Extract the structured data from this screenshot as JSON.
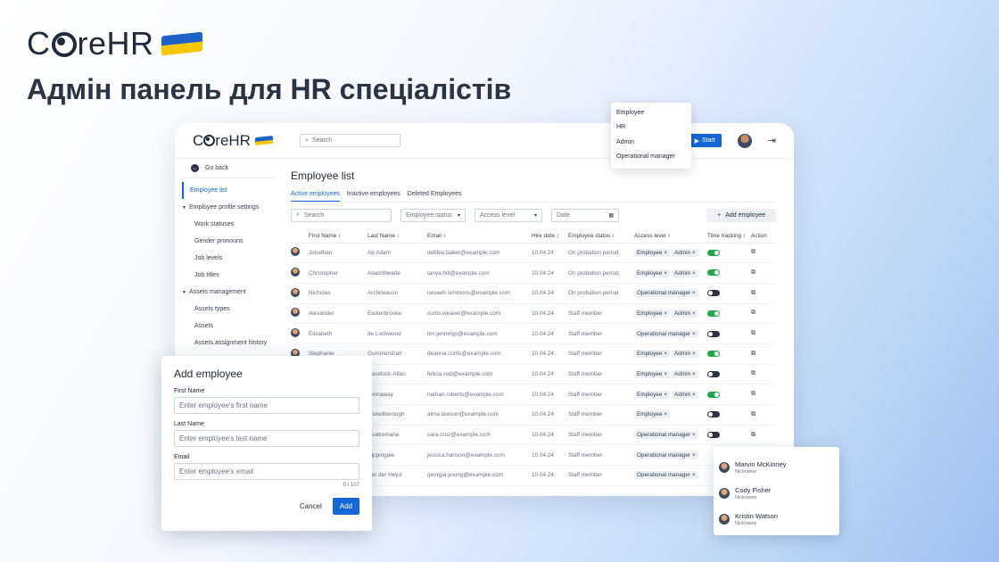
{
  "brand": {
    "name_pre": "C",
    "name_post": "reHR"
  },
  "headline": "Адмін панель для HR спеціалістів",
  "colors": {
    "accent": "#1467d6",
    "toggle_on": "#22a84a",
    "toggle_off": "#2a3444",
    "flag_blue": "#1d63c7",
    "flag_yellow": "#f6c700"
  },
  "topbar": {
    "search_placeholder": "Search",
    "start_label": "Start",
    "logout_icon": "logout-icon"
  },
  "sidebar": {
    "back_label": "Go back",
    "items": [
      {
        "label": "Employee list",
        "kind": "active"
      },
      {
        "label": "Employee profile settings",
        "kind": "group"
      },
      {
        "label": "Work statuses",
        "kind": "sub"
      },
      {
        "label": "Gender pronouns",
        "kind": "sub"
      },
      {
        "label": "Job levels",
        "kind": "sub"
      },
      {
        "label": "Job titles",
        "kind": "sub"
      },
      {
        "label": "Assets management",
        "kind": "group"
      },
      {
        "label": "Assets types",
        "kind": "sub"
      },
      {
        "label": "Assets",
        "kind": "sub"
      },
      {
        "label": "Assets assignment history",
        "kind": "sub"
      }
    ]
  },
  "main": {
    "title": "Employee list",
    "tabs": [
      "Active employees",
      "Inactive employees",
      "Deleted Employees"
    ],
    "filters": {
      "search": "Search",
      "status": "Employee status",
      "access": "Access level",
      "date": "Date"
    },
    "add_button": "Add employee"
  },
  "table": {
    "headers": [
      "First Name",
      "Last Name",
      "Email",
      "Hire date",
      "Employee status",
      "Access level",
      "Time tracking",
      "Action"
    ],
    "rows": [
      {
        "first": "Jonathan",
        "last": "Ab Adam",
        "email": "debbie.baker@example.com",
        "date": "10.04.24",
        "status": "On probation period",
        "access": [
          "Employee ×",
          "Admin ×"
        ],
        "tracking": "on"
      },
      {
        "first": "Christopher",
        "last": "Adamthwaite",
        "email": "tanya.hill@example.com",
        "date": "10.04.24",
        "status": "On probation period",
        "access": [
          "Employee ×",
          "Admin ×"
        ],
        "tracking": "on"
      },
      {
        "first": "Nicholas",
        "last": "Archdeacon",
        "email": "nevaeh.simmons@example.com",
        "date": "10.04.24",
        "status": "On probation period",
        "access": [
          "Operational manager ×"
        ],
        "tracking": "off"
      },
      {
        "first": "Alexander",
        "last": "Easterbrooke",
        "email": "curtis.weaver@example.com",
        "date": "10.04.24",
        "status": "Staff member",
        "access": [
          "Employee ×",
          "Admin ×"
        ],
        "tracking": "on"
      },
      {
        "first": "Elizabeth",
        "last": "de Lockwood",
        "email": "tim.jennings@example.com",
        "date": "10.04.24",
        "status": "Staff member",
        "access": [
          "Operational manager ×"
        ],
        "tracking": "off"
      },
      {
        "first": "Stephanie",
        "last": "Gummershall",
        "email": "deanna.curtis@example.com",
        "date": "10.04.24",
        "status": "Staff member",
        "access": [
          "Employee ×",
          "Admin ×"
        ],
        "tracking": "on"
      },
      {
        "first": "",
        "last": "Havelock-Allan",
        "email": "felicia.reid@example.com",
        "date": "10.04.24",
        "status": "Staff member",
        "access": [
          "Employee ×",
          "Admin ×"
        ],
        "tracking": "off"
      },
      {
        "first": "",
        "last": "Jennaway",
        "email": "nathan.roberts@example.com",
        "date": "10.04.24",
        "status": "Staff member",
        "access": [
          "Employee ×",
          "Admin ×"
        ],
        "tracking": "on"
      },
      {
        "first": "",
        "last": "Mickelborough",
        "email": "alma.lawson@example.com",
        "date": "10.04.24",
        "status": "Staff member",
        "access": [
          "Employee ×"
        ],
        "tracking": "off"
      },
      {
        "first": "",
        "last": "Quatremane",
        "email": "sara.cruz@example.com",
        "date": "10.04.24",
        "status": "Staff member",
        "access": [
          "Operational manager ×"
        ],
        "tracking": "off"
      },
      {
        "first": "",
        "last": "Rippingale",
        "email": "jessica.hanson@example.com",
        "date": "10.04.24",
        "status": "Staff member",
        "access": [
          "Operational manager ×"
        ],
        "tracking": ""
      },
      {
        "first": "",
        "last": "van der Heyd",
        "email": "georgia.young@example.com",
        "date": "10.04.24",
        "status": "Staff member",
        "access": [
          "Operational manager ×"
        ],
        "tracking": ""
      }
    ]
  },
  "role_menu": [
    "Employee",
    "HR",
    "Admin",
    "Operational manager"
  ],
  "modal": {
    "title": "Add employee",
    "first_label": "First Name",
    "first_placeholder": "Enter employee's first name",
    "last_label": "Last Name",
    "last_placeholder": "Enter employee's last name",
    "email_label": "Email",
    "email_placeholder": "Enter employee's email",
    "counter": "0 / 107",
    "cancel": "Cancel",
    "add": "Add"
  },
  "nicknames": [
    {
      "name": "Marvin McKinney",
      "sub": "Nickname"
    },
    {
      "name": "Cody Fisher",
      "sub": "Nickname"
    },
    {
      "name": "Kristin Watson",
      "sub": "Nickname"
    }
  ]
}
